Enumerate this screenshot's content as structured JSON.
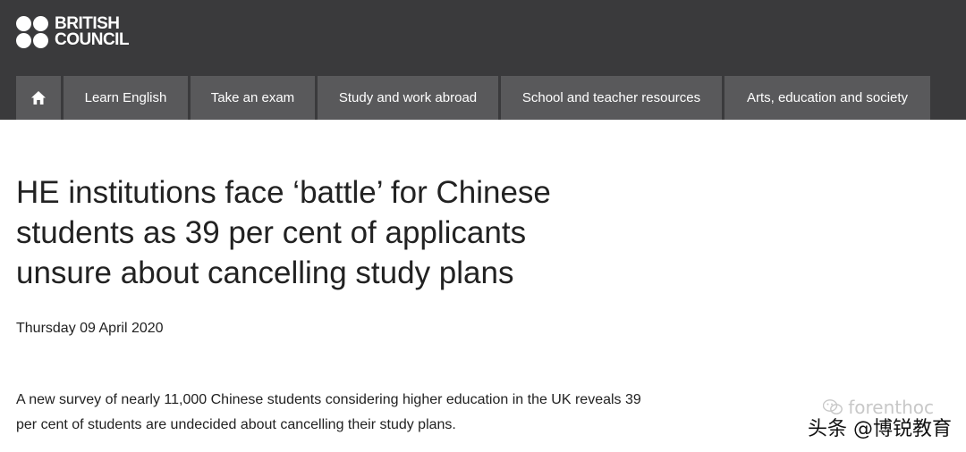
{
  "brand": {
    "line1": "BRITISH",
    "line2": "COUNCIL",
    "logo_icon": "four-dots-logo"
  },
  "nav": {
    "home_icon": "home-icon",
    "items": [
      {
        "label": "Learn English"
      },
      {
        "label": "Take an exam"
      },
      {
        "label": "Study and work abroad"
      },
      {
        "label": "School and teacher resources"
      },
      {
        "label": "Arts, education and society"
      }
    ]
  },
  "article": {
    "title": "HE institutions face ‘battle’ for Chinese students as 39 per cent of applicants unsure about cancelling study plans",
    "date": "Thursday 09 April 2020",
    "lede": "A new survey of nearly 11,000 Chinese students considering higher education in the UK reveals 39 per cent of students are undecided about cancelling their study plans."
  },
  "watermark": {
    "top": "forenthoc",
    "bottom": "头条 @博锐教育",
    "icon": "wechat-icon"
  },
  "colors": {
    "header_bg": "#3a3a3c",
    "nav_item_bg": "#59595b",
    "text": "#222222"
  }
}
